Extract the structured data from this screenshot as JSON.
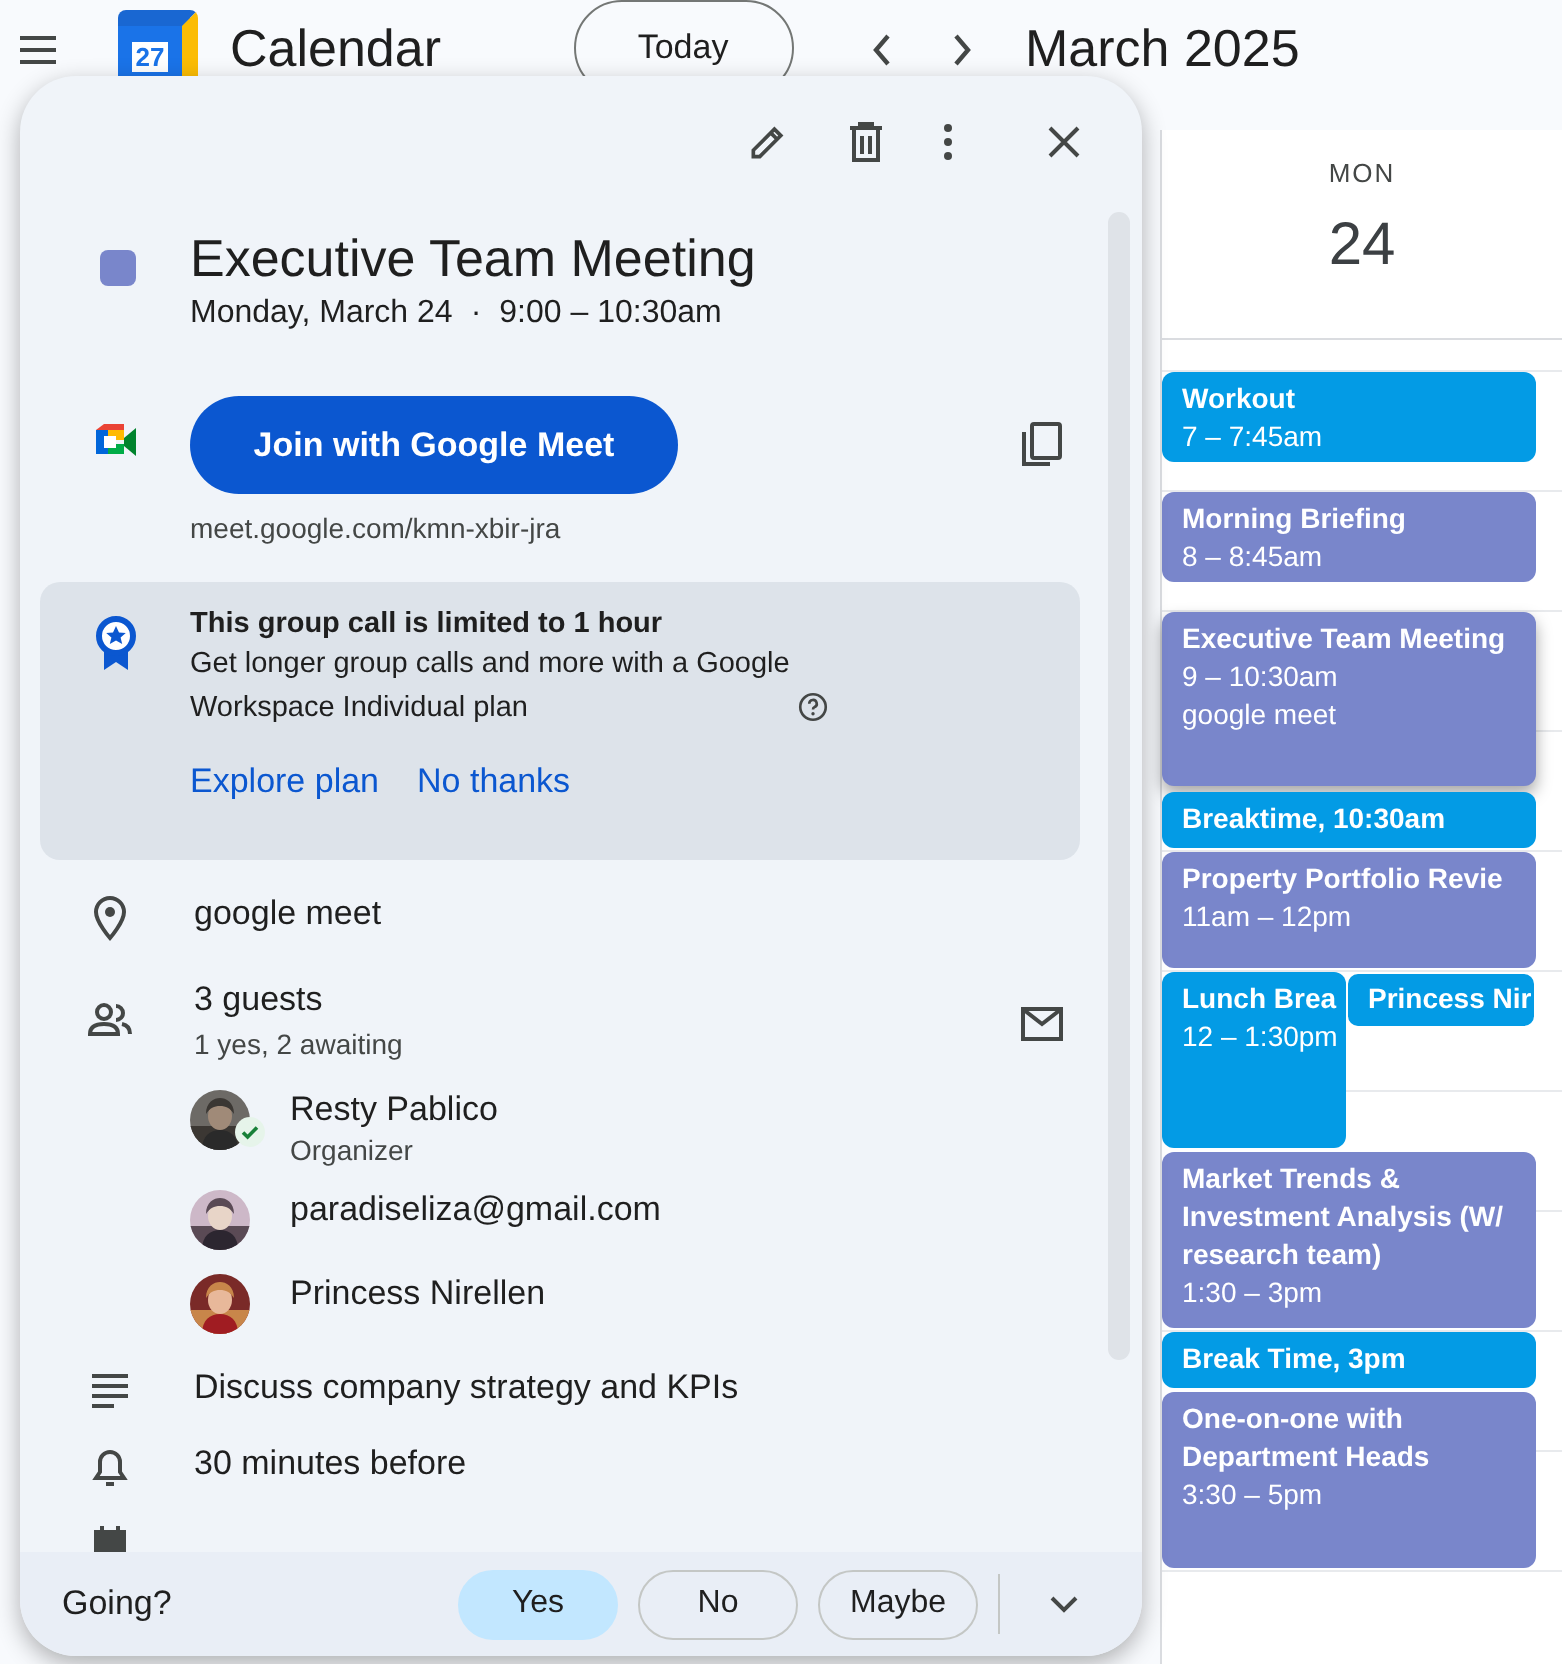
{
  "header": {
    "app_name": "Calendar",
    "logo_day": "27",
    "today_button": "Today",
    "period": "March 2025"
  },
  "day": {
    "weekday": "MON",
    "date": "24"
  },
  "events": [
    {
      "kind": "block",
      "title": "Workout",
      "time": "7 – 7:45am",
      "color": "#039be5",
      "selected": false
    },
    {
      "kind": "block",
      "title": "Morning Briefing",
      "time": "8 – 8:45am",
      "color": "#7986cb",
      "selected": false
    },
    {
      "kind": "block",
      "title": "Executive Team Meeting",
      "time": "9 – 10:30am",
      "location": "google meet",
      "color": "#7986cb",
      "selected": true
    },
    {
      "kind": "compact",
      "title": "Breaktime, 10:30am",
      "color": "#039be5",
      "selected": false
    },
    {
      "kind": "block",
      "title": "Property Portfolio Revie",
      "time": "11am – 12pm",
      "color": "#7986cb",
      "selected": false
    },
    {
      "kind": "block",
      "title": "Lunch Brea",
      "time": "12 – 1:30pm",
      "color": "#039be5",
      "selected": false
    },
    {
      "kind": "chip",
      "title": "Princess Nir",
      "color": "#039be5",
      "selected": false
    },
    {
      "kind": "block",
      "title": "Market Trends & Investment Analysis (W/ research team)",
      "time": "1:30 – 3pm",
      "color": "#7986cb",
      "selected": false
    },
    {
      "kind": "compact",
      "title": "Break Time, 3pm",
      "color": "#039be5",
      "selected": false
    },
    {
      "kind": "block",
      "title": "One-on-one with Department Heads",
      "time": "3:30 – 5pm",
      "color": "#7986cb",
      "selected": false
    }
  ],
  "popup": {
    "title": "Executive Team Meeting",
    "color": "#7986cb",
    "date": "Monday, March 24",
    "separator": "·",
    "time": "9:00 – 10:30am",
    "meet_button": "Join with Google Meet",
    "meet_link": "meet.google.com/kmn-xbir-jra",
    "banner": {
      "heading": "This group call is limited to 1 hour",
      "body": "Get longer group calls and more with a Google Workspace Individual plan",
      "actions": [
        "Explore plan",
        "No thanks"
      ]
    },
    "location": "google meet",
    "guests_title": "3 guests",
    "guests_summary": "1 yes, 2 awaiting",
    "guests": [
      {
        "name": "Resty Pablico",
        "role": "Organizer",
        "accepted": true
      },
      {
        "name": "paradiseliza@gmail.com",
        "accepted": false
      },
      {
        "name": "Princess Nirellen",
        "accepted": false
      }
    ],
    "description": "Discuss company strategy and KPIs",
    "reminder": "30 minutes before",
    "rsvp": {
      "label": "Going?",
      "options": [
        {
          "label": "Yes",
          "selected": true
        },
        {
          "label": "No",
          "selected": false
        },
        {
          "label": "Maybe",
          "selected": false
        }
      ]
    }
  }
}
